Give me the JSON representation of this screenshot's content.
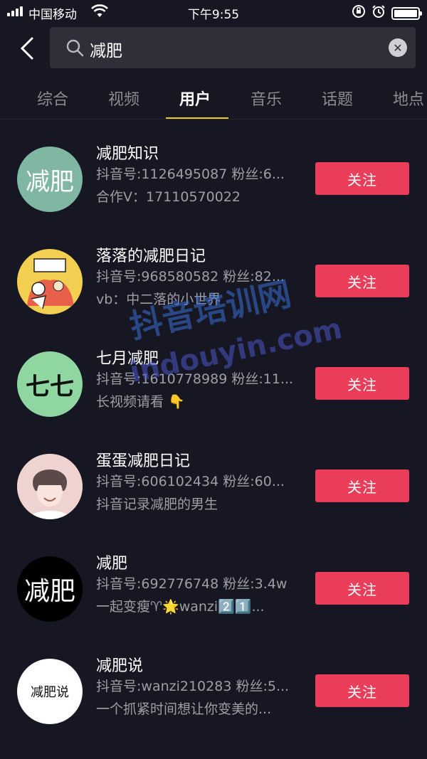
{
  "status_bar": {
    "carrier": "中国移动",
    "time": "下午9:55"
  },
  "search": {
    "query": "减肥"
  },
  "tabs": [
    {
      "label": "综合"
    },
    {
      "label": "视频"
    },
    {
      "label": "用户"
    },
    {
      "label": "音乐"
    },
    {
      "label": "话题"
    },
    {
      "label": "地点"
    }
  ],
  "active_tab": "用户",
  "colors": {
    "background": "#161722",
    "follow_button": "#ea3d59",
    "tab_indicator": "#f8c61c"
  },
  "users": [
    {
      "name": "减肥知识",
      "info": "抖音号:1126495087  粉丝:6...",
      "bio": "合作V：17110570022",
      "follow_label": "关注",
      "avatar_text": "减肥"
    },
    {
      "name": "落落的减肥日记",
      "info": "抖音号:968580582  粉丝:82...",
      "bio": "vb：中二落的小世界",
      "follow_label": "关注"
    },
    {
      "name": "七月减肥",
      "info": "抖音号:1610778989  粉丝:11...",
      "bio": "长视频请看 👇",
      "follow_label": "关注",
      "avatar_text": "七七"
    },
    {
      "name": "蛋蛋减肥日记",
      "info": "抖音号:606102434  粉丝:60...",
      "bio": "抖音记录减肥的男生",
      "follow_label": "关注"
    },
    {
      "name": "减肥",
      "info": "抖音号:692776748  粉丝:3.4w",
      "bio": "一起变瘦♈🌟wanzi2️⃣1️⃣...",
      "follow_label": "关注",
      "avatar_text": "减肥"
    },
    {
      "name": "减肥说",
      "info": "抖音号:wanzi210283  粉丝:5...",
      "bio": "一个抓紧时间想让你变美的...",
      "follow_label": "关注",
      "avatar_text": "减肥说"
    }
  ],
  "watermark": {
    "title": "抖音培训网",
    "url": "indouyin.com"
  }
}
